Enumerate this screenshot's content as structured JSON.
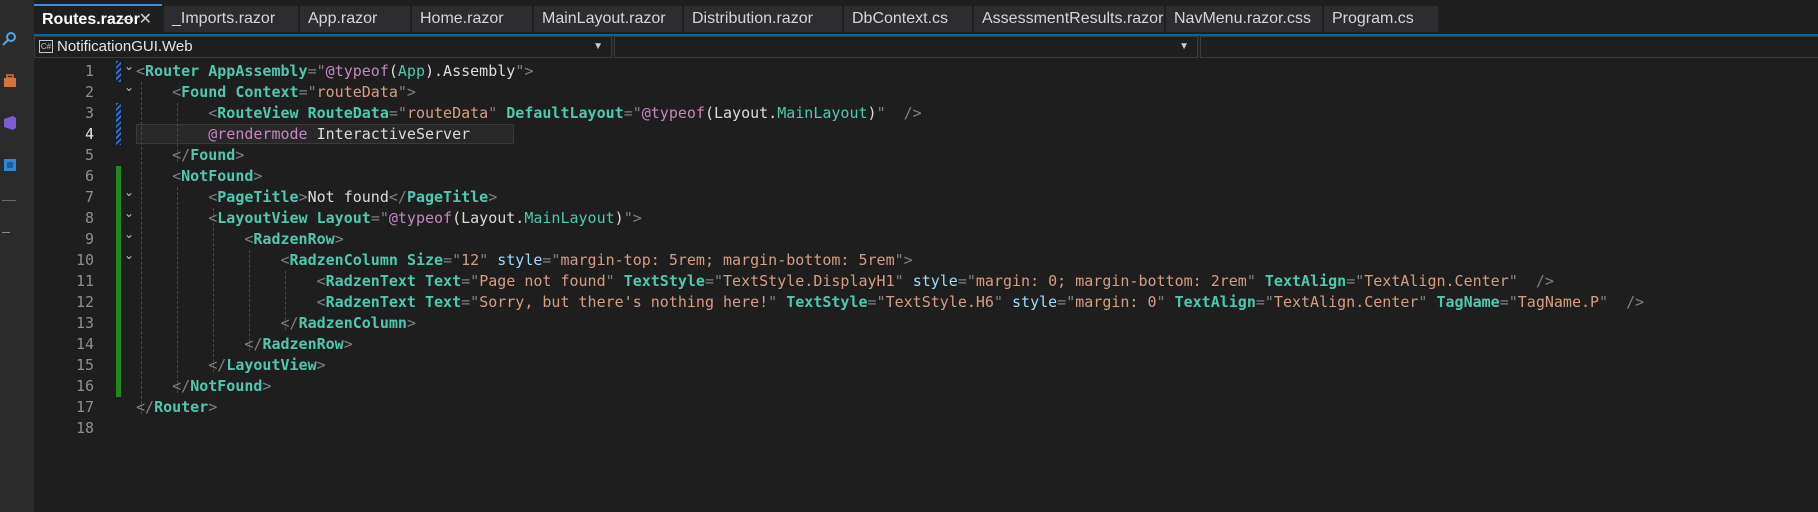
{
  "tabs": [
    {
      "label": "Routes.razor",
      "active": true
    },
    {
      "label": "_Imports.razor"
    },
    {
      "label": "App.razor"
    },
    {
      "label": "Home.razor"
    },
    {
      "label": "MainLayout.razor"
    },
    {
      "label": "Distribution.razor"
    },
    {
      "label": "DbContext.cs"
    },
    {
      "label": "AssessmentResults.razor"
    },
    {
      "label": "NavMenu.razor.css"
    },
    {
      "label": "Program.cs"
    }
  ],
  "navbar": {
    "project": "NotificationGUI.Web",
    "member": ""
  },
  "editor": {
    "current_line": 4,
    "line_numbers": [
      "1",
      "2",
      "3",
      "4",
      "5",
      "6",
      "7",
      "8",
      "9",
      "10",
      "11",
      "12",
      "13",
      "14",
      "15",
      "16",
      "17",
      "18"
    ],
    "lines": [
      {
        "indent": "",
        "tokens": [
          [
            "br",
            "<"
          ],
          [
            "tag",
            "Router "
          ],
          [
            "attr",
            "AppAssembly"
          ],
          [
            "br",
            "=\""
          ],
          [
            "at",
            "@"
          ],
          [
            "at",
            "typeof"
          ],
          [
            "plain",
            "("
          ],
          [
            "type",
            "App"
          ],
          [
            "plain",
            ").Assembly"
          ],
          [
            "br",
            "\">"
          ]
        ]
      },
      {
        "indent": "    ",
        "tokens": [
          [
            "br",
            "<"
          ],
          [
            "tag",
            "Found "
          ],
          [
            "attr",
            "Context"
          ],
          [
            "br",
            "=\""
          ],
          [
            "str",
            "routeData"
          ],
          [
            "br",
            "\">"
          ]
        ]
      },
      {
        "indent": "        ",
        "tokens": [
          [
            "br",
            "<"
          ],
          [
            "tag",
            "RouteView "
          ],
          [
            "attr",
            "RouteData"
          ],
          [
            "br",
            "=\""
          ],
          [
            "str",
            "routeData"
          ],
          [
            "br",
            "\" "
          ],
          [
            "attr",
            "DefaultLayout"
          ],
          [
            "br",
            "=\""
          ],
          [
            "at",
            "@typeof"
          ],
          [
            "plain",
            "(Layout."
          ],
          [
            "type",
            "MainLayout"
          ],
          [
            "plain",
            ")"
          ],
          [
            "br",
            "\"  />"
          ]
        ]
      },
      {
        "indent": "        ",
        "tokens": [
          [
            "at",
            "@rendermode"
          ],
          [
            "plain",
            " InteractiveServer"
          ]
        ]
      },
      {
        "indent": "    ",
        "tokens": [
          [
            "br",
            "</"
          ],
          [
            "tag",
            "Found"
          ],
          [
            "br",
            ">"
          ]
        ]
      },
      {
        "indent": "    ",
        "tokens": [
          [
            "br",
            "<"
          ],
          [
            "tag",
            "NotFound"
          ],
          [
            "br",
            ">"
          ]
        ]
      },
      {
        "indent": "        ",
        "tokens": [
          [
            "br",
            "<"
          ],
          [
            "tag",
            "PageTitle"
          ],
          [
            "br",
            ">"
          ],
          [
            "plain",
            "Not found"
          ],
          [
            "br",
            "</"
          ],
          [
            "tag",
            "PageTitle"
          ],
          [
            "br",
            ">"
          ]
        ]
      },
      {
        "indent": "        ",
        "tokens": [
          [
            "br",
            "<"
          ],
          [
            "tag",
            "LayoutView "
          ],
          [
            "attr",
            "Layout"
          ],
          [
            "br",
            "=\""
          ],
          [
            "at",
            "@typeof"
          ],
          [
            "plain",
            "(Layout."
          ],
          [
            "type",
            "MainLayout"
          ],
          [
            "plain",
            ")"
          ],
          [
            "br",
            "\">"
          ]
        ]
      },
      {
        "indent": "            ",
        "tokens": [
          [
            "br",
            "<"
          ],
          [
            "tag",
            "RadzenRow"
          ],
          [
            "br",
            ">"
          ]
        ]
      },
      {
        "indent": "                ",
        "tokens": [
          [
            "br",
            "<"
          ],
          [
            "tag",
            "RadzenColumn "
          ],
          [
            "attr",
            "Size"
          ],
          [
            "br",
            "=\""
          ],
          [
            "str",
            "12"
          ],
          [
            "br",
            "\" "
          ],
          [
            "attr2",
            "style"
          ],
          [
            "br",
            "=\""
          ],
          [
            "str",
            "margin-top: 5rem; margin-bottom: 5rem"
          ],
          [
            "br",
            "\">"
          ]
        ]
      },
      {
        "indent": "                    ",
        "tokens": [
          [
            "br",
            "<"
          ],
          [
            "tag",
            "RadzenText "
          ],
          [
            "attr",
            "Text"
          ],
          [
            "br",
            "=\""
          ],
          [
            "str",
            "Page not found"
          ],
          [
            "br",
            "\" "
          ],
          [
            "attr",
            "TextStyle"
          ],
          [
            "br",
            "=\""
          ],
          [
            "str",
            "TextStyle.DisplayH1"
          ],
          [
            "br",
            "\" "
          ],
          [
            "attr2",
            "style"
          ],
          [
            "br",
            "=\""
          ],
          [
            "str",
            "margin: 0; margin-bottom: 2rem"
          ],
          [
            "br",
            "\" "
          ],
          [
            "attr",
            "TextAlign"
          ],
          [
            "br",
            "=\""
          ],
          [
            "str",
            "TextAlign.Center"
          ],
          [
            "br",
            "\"  />"
          ]
        ]
      },
      {
        "indent": "                    ",
        "tokens": [
          [
            "br",
            "<"
          ],
          [
            "tag",
            "RadzenText "
          ],
          [
            "attr",
            "Text"
          ],
          [
            "br",
            "=\""
          ],
          [
            "str",
            "Sorry, but there's nothing here!"
          ],
          [
            "br",
            "\" "
          ],
          [
            "attr",
            "TextStyle"
          ],
          [
            "br",
            "=\""
          ],
          [
            "str",
            "TextStyle.H6"
          ],
          [
            "br",
            "\" "
          ],
          [
            "attr2",
            "style"
          ],
          [
            "br",
            "=\""
          ],
          [
            "str",
            "margin: 0"
          ],
          [
            "br",
            "\" "
          ],
          [
            "attr",
            "TextAlign"
          ],
          [
            "br",
            "=\""
          ],
          [
            "str",
            "TextAlign.Center"
          ],
          [
            "br",
            "\" "
          ],
          [
            "attr",
            "TagName"
          ],
          [
            "br",
            "=\""
          ],
          [
            "str",
            "TagName.P"
          ],
          [
            "br",
            "\"  />"
          ]
        ]
      },
      {
        "indent": "                ",
        "tokens": [
          [
            "br",
            "</"
          ],
          [
            "tag",
            "RadzenColumn"
          ],
          [
            "br",
            ">"
          ]
        ]
      },
      {
        "indent": "            ",
        "tokens": [
          [
            "br",
            "</"
          ],
          [
            "tag",
            "RadzenRow"
          ],
          [
            "br",
            ">"
          ]
        ]
      },
      {
        "indent": "        ",
        "tokens": [
          [
            "br",
            "</"
          ],
          [
            "tag",
            "LayoutView"
          ],
          [
            "br",
            ">"
          ]
        ]
      },
      {
        "indent": "    ",
        "tokens": [
          [
            "br",
            "</"
          ],
          [
            "tag",
            "NotFound"
          ],
          [
            "br",
            ">"
          ]
        ]
      },
      {
        "indent": "",
        "tokens": [
          [
            "br",
            "</"
          ],
          [
            "tag",
            "Router"
          ],
          [
            "br",
            ">"
          ]
        ]
      },
      {
        "indent": "",
        "tokens": []
      }
    ]
  },
  "icons": [
    "search-icon",
    "toolbox-icon",
    "visual-studio-icon",
    "solution-explorer-icon"
  ]
}
